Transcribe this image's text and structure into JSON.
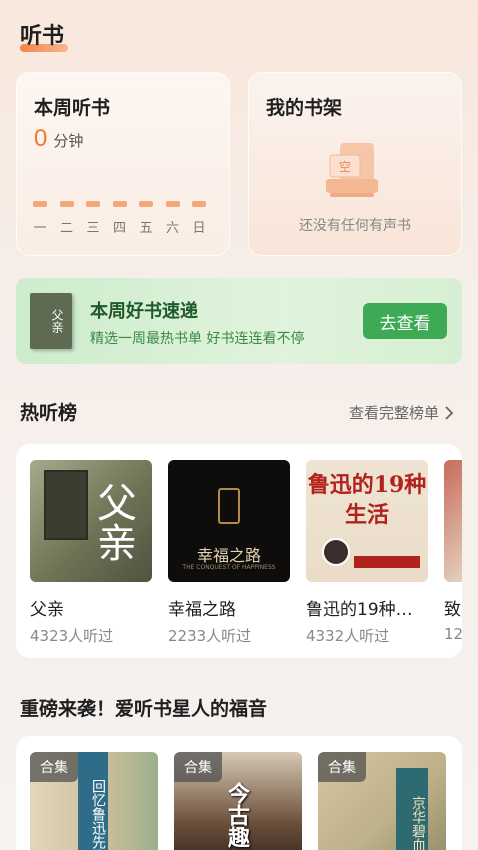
{
  "header": {
    "title": "听书"
  },
  "week_card": {
    "title": "本周听书",
    "minutes": "0",
    "unit": "分钟",
    "days": [
      "一",
      "二",
      "三",
      "四",
      "五",
      "六",
      "日"
    ]
  },
  "shelf_card": {
    "title": "我的书架",
    "illustration_text": "空",
    "empty_text": "还没有任何有声书"
  },
  "banner": {
    "title": "本周好书速递",
    "subtitle": "精选一周最热书单 好书连连看不停",
    "button": "去查看",
    "cover_text": "父亲"
  },
  "ranking": {
    "title": "热听榜",
    "more_link": "查看完整榜单",
    "books": [
      {
        "name": "父亲",
        "plays": "4323人听过",
        "cover_text": "父亲"
      },
      {
        "name": "幸福之路",
        "plays": "2233人听过",
        "cover_text": "幸福之路",
        "cover_subtext": "THE CONQUEST OF HAPPINESS"
      },
      {
        "name": "鲁迅的19种…",
        "plays": "4332人听过",
        "cover_text": "鲁迅的19种生活"
      },
      {
        "name": "致",
        "plays": "12"
      }
    ]
  },
  "collections": {
    "title": "重磅来袭！爱听书星人的福音",
    "items": [
      {
        "badge": "合集",
        "cover_text": "回忆鲁迅先生"
      },
      {
        "badge": "合集",
        "cover_text": "今古趣"
      },
      {
        "badge": "合集",
        "cover_text": "京华碧血"
      }
    ]
  },
  "colors": {
    "accent_orange": "#f07a30",
    "banner_green": "#3faa55",
    "banner_title": "#1f5a2a"
  }
}
